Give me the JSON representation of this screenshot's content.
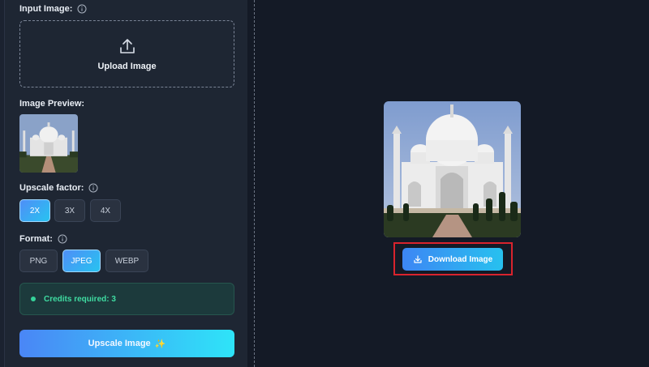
{
  "labels": {
    "input_image": "Input Image:",
    "image_preview": "Image Preview:",
    "upscale_factor": "Upscale factor:",
    "format": "Format:"
  },
  "upload": {
    "text": "Upload Image"
  },
  "upscale_factors": [
    {
      "label": "2X",
      "selected": true
    },
    {
      "label": "3X",
      "selected": false
    },
    {
      "label": "4X",
      "selected": false
    }
  ],
  "formats": [
    {
      "label": "PNG",
      "selected": false
    },
    {
      "label": "JPEG",
      "selected": true
    },
    {
      "label": "WEBP",
      "selected": false
    }
  ],
  "credits": {
    "text": "Credits required: 3"
  },
  "upscale_button": {
    "label": "Upscale Image",
    "emoji": "✨"
  },
  "download_button": {
    "label": "Download Image"
  },
  "colors": {
    "accent_gradient_start": "#4a86f6",
    "accent_gradient_end": "#2ee4f8",
    "credits_green": "#3fdca2",
    "highlight_red": "#d9232d"
  },
  "icons": [
    "info-icon",
    "upload-icon",
    "download-icon",
    "sparkles-icon"
  ]
}
